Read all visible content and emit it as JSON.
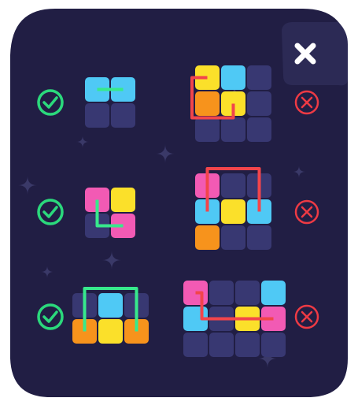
{
  "colors": {
    "panel": "#211e44",
    "panel_border": "#ffffff",
    "corner_notch": "#2c2a55",
    "empty": "#383872",
    "cyan": "#4fc9f5",
    "yellow": "#fbe02a",
    "pink": "#f25ab4",
    "orange": "#f7931c",
    "green_line": "#37e98c",
    "red_line": "#f2454b",
    "check": "#2bd97c",
    "cross": "#ee3a44",
    "close_x": "#ffffff"
  },
  "icons": {
    "close": "close-x-icon",
    "correct": "check-circle-icon",
    "wrong": "cross-circle-icon"
  },
  "examples": [
    {
      "verdict": "correct",
      "grid": [
        [
          "cyan",
          "cyan"
        ],
        [
          "empty",
          "empty"
        ]
      ],
      "path": [
        [
          0,
          0
        ],
        [
          0,
          1
        ]
      ]
    },
    {
      "verdict": "wrong",
      "grid": [
        [
          "yellow",
          "cyan",
          "empty"
        ],
        [
          "orange",
          "yellow",
          "empty"
        ],
        [
          "empty",
          "empty",
          "empty"
        ]
      ],
      "path": [
        [
          0,
          0
        ],
        [
          1,
          1
        ]
      ]
    },
    {
      "verdict": "correct",
      "grid": [
        [
          "pink",
          "yellow"
        ],
        [
          "empty",
          "pink"
        ]
      ],
      "path": [
        [
          0,
          0
        ],
        [
          1,
          1
        ]
      ]
    },
    {
      "verdict": "wrong",
      "grid": [
        [
          "pink",
          "empty",
          "empty"
        ],
        [
          "cyan",
          "yellow",
          "cyan"
        ],
        [
          "orange",
          "empty",
          "empty"
        ]
      ],
      "path": [
        [
          1,
          0
        ],
        [
          1,
          2
        ]
      ]
    },
    {
      "verdict": "correct",
      "grid": [
        [
          "empty",
          "cyan",
          "empty"
        ],
        [
          "orange",
          "yellow",
          "orange"
        ]
      ],
      "path": [
        [
          1,
          0
        ],
        [
          1,
          2
        ]
      ]
    },
    {
      "verdict": "wrong",
      "grid": [
        [
          "pink",
          "empty",
          "empty",
          "cyan"
        ],
        [
          "cyan",
          "empty",
          "yellow",
          "pink"
        ],
        [
          "empty",
          "empty",
          "empty",
          "empty"
        ]
      ],
      "path": [
        [
          0,
          0
        ],
        [
          1,
          3
        ]
      ]
    }
  ]
}
